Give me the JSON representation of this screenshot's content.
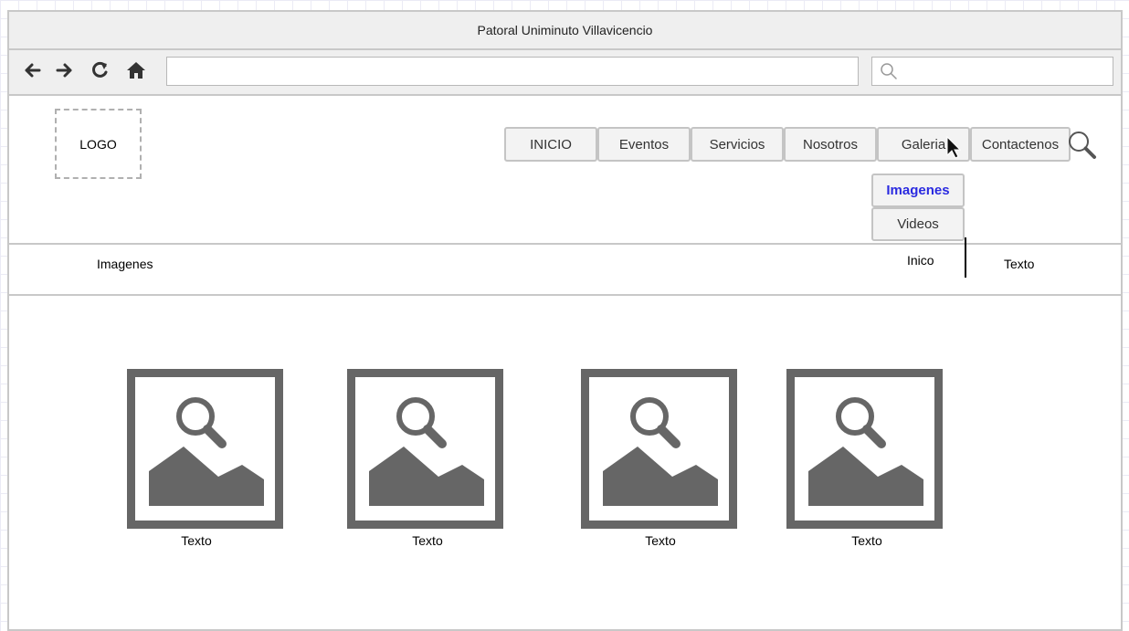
{
  "window": {
    "title": "Patoral Uniminuto Villavicencio"
  },
  "browser": {
    "url": "",
    "search_placeholder": "",
    "icons": [
      "back-arrow-icon",
      "forward-arrow-icon",
      "reload-icon",
      "home-icon",
      "search-icon"
    ]
  },
  "header": {
    "logo": "LOGO",
    "nav": [
      "INICIO",
      "Eventos",
      "Servicios",
      "Nosotros",
      "Galeria",
      "Contactenos"
    ],
    "dropdown": [
      "Imagenes",
      "Videos"
    ],
    "active_dropdown": "Imagenes"
  },
  "subheader": {
    "title": "Imagenes",
    "link_home": "Inico",
    "link_text": "Texto"
  },
  "gallery": [
    {
      "caption": "Texto",
      "icon": "image-placeholder-icon"
    },
    {
      "caption": "Texto",
      "icon": "image-placeholder-icon"
    },
    {
      "caption": "Texto",
      "icon": "image-placeholder-icon"
    },
    {
      "caption": "Texto",
      "icon": "image-placeholder-icon"
    }
  ],
  "colors": {
    "active_link": "#2a2ae0",
    "placeholder_gray": "#666666",
    "frame_border": "#c8c8c8"
  }
}
